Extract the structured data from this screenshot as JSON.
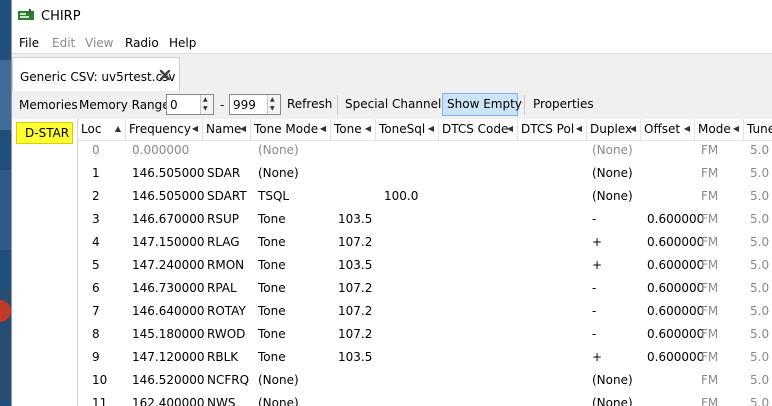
{
  "window": {
    "title": "CHIRP"
  },
  "menu": [
    {
      "label": "File",
      "enabled": true
    },
    {
      "label": "Edit",
      "enabled": false
    },
    {
      "label": "View",
      "enabled": false
    },
    {
      "label": "Radio",
      "enabled": true
    },
    {
      "label": "Help",
      "enabled": true
    }
  ],
  "tab": {
    "label": "Generic CSV: uv5rtest.csv"
  },
  "toolbar": {
    "memories_label": "Memories",
    "range_label": "Memory Range:",
    "range_start": "0",
    "range_dash": "-",
    "range_end": "999",
    "refresh_label": "Refresh",
    "special_label": "Special Channels",
    "show_empty_label": "Show Empty",
    "properties_label": "Properties"
  },
  "sidebar": {
    "items": [
      {
        "label": "D-STAR",
        "highlight": "#ffff33"
      }
    ]
  },
  "table": {
    "columns": [
      "Loc",
      "Frequency",
      "Name",
      "Tone Mode",
      "Tone",
      "ToneSql",
      "DTCS Code",
      "DTCS Pol",
      "Duplex",
      "Offset",
      "Mode",
      "Tune S"
    ],
    "sort_arrow": "▲",
    "col_arrow": "◀",
    "rows": [
      {
        "loc": "0",
        "freq": "0.000000",
        "name": "",
        "tmode": "(None)",
        "tone": "",
        "tsql": "",
        "duplex": "(None)",
        "offset": "",
        "mode": "FM",
        "tune": "5.0",
        "empty": true
      },
      {
        "loc": "1",
        "freq": "146.505000",
        "name": "SDAR",
        "tmode": "(None)",
        "tone": "",
        "tsql": "",
        "duplex": "(None)",
        "offset": "",
        "mode": "FM",
        "tune": "5.0"
      },
      {
        "loc": "2",
        "freq": "146.505000",
        "name": "SDART",
        "tmode": "TSQL",
        "tone": "",
        "tsql": "100.0",
        "duplex": "(None)",
        "offset": "",
        "mode": "FM",
        "tune": "5.0"
      },
      {
        "loc": "3",
        "freq": "146.670000",
        "name": "RSUP",
        "tmode": "Tone",
        "tone": "103.5",
        "tsql": "",
        "duplex": "-",
        "offset": "0.600000",
        "mode": "FM",
        "tune": "5.0"
      },
      {
        "loc": "4",
        "freq": "147.150000",
        "name": "RLAG",
        "tmode": "Tone",
        "tone": "107.2",
        "tsql": "",
        "duplex": "+",
        "offset": "0.600000",
        "mode": "FM",
        "tune": "5.0"
      },
      {
        "loc": "5",
        "freq": "147.240000",
        "name": "RMON",
        "tmode": "Tone",
        "tone": "103.5",
        "tsql": "",
        "duplex": "+",
        "offset": "0.600000",
        "mode": "FM",
        "tune": "5.0"
      },
      {
        "loc": "6",
        "freq": "146.730000",
        "name": "RPAL",
        "tmode": "Tone",
        "tone": "107.2",
        "tsql": "",
        "duplex": "-",
        "offset": "0.600000",
        "mode": "FM",
        "tune": "5.0"
      },
      {
        "loc": "7",
        "freq": "146.640000",
        "name": "ROTAY",
        "tmode": "Tone",
        "tone": "107.2",
        "tsql": "",
        "duplex": "-",
        "offset": "0.600000",
        "mode": "FM",
        "tune": "5.0"
      },
      {
        "loc": "8",
        "freq": "145.180000",
        "name": "RWOD",
        "tmode": "Tone",
        "tone": "107.2",
        "tsql": "",
        "duplex": "-",
        "offset": "0.600000",
        "mode": "FM",
        "tune": "5.0"
      },
      {
        "loc": "9",
        "freq": "147.120000",
        "name": "RBLK",
        "tmode": "Tone",
        "tone": "103.5",
        "tsql": "",
        "duplex": "+",
        "offset": "0.600000",
        "mode": "FM",
        "tune": "5.0"
      },
      {
        "loc": "10",
        "freq": "146.520000",
        "name": "NCFRQ",
        "tmode": "(None)",
        "tone": "",
        "tsql": "",
        "duplex": "(None)",
        "offset": "",
        "mode": "FM",
        "tune": "5.0"
      },
      {
        "loc": "11",
        "freq": "162.400000",
        "name": "NWS",
        "tmode": "(None)",
        "tone": "",
        "tsql": "",
        "duplex": "(None)",
        "offset": "",
        "mode": "FM",
        "tune": "5.0"
      }
    ]
  }
}
